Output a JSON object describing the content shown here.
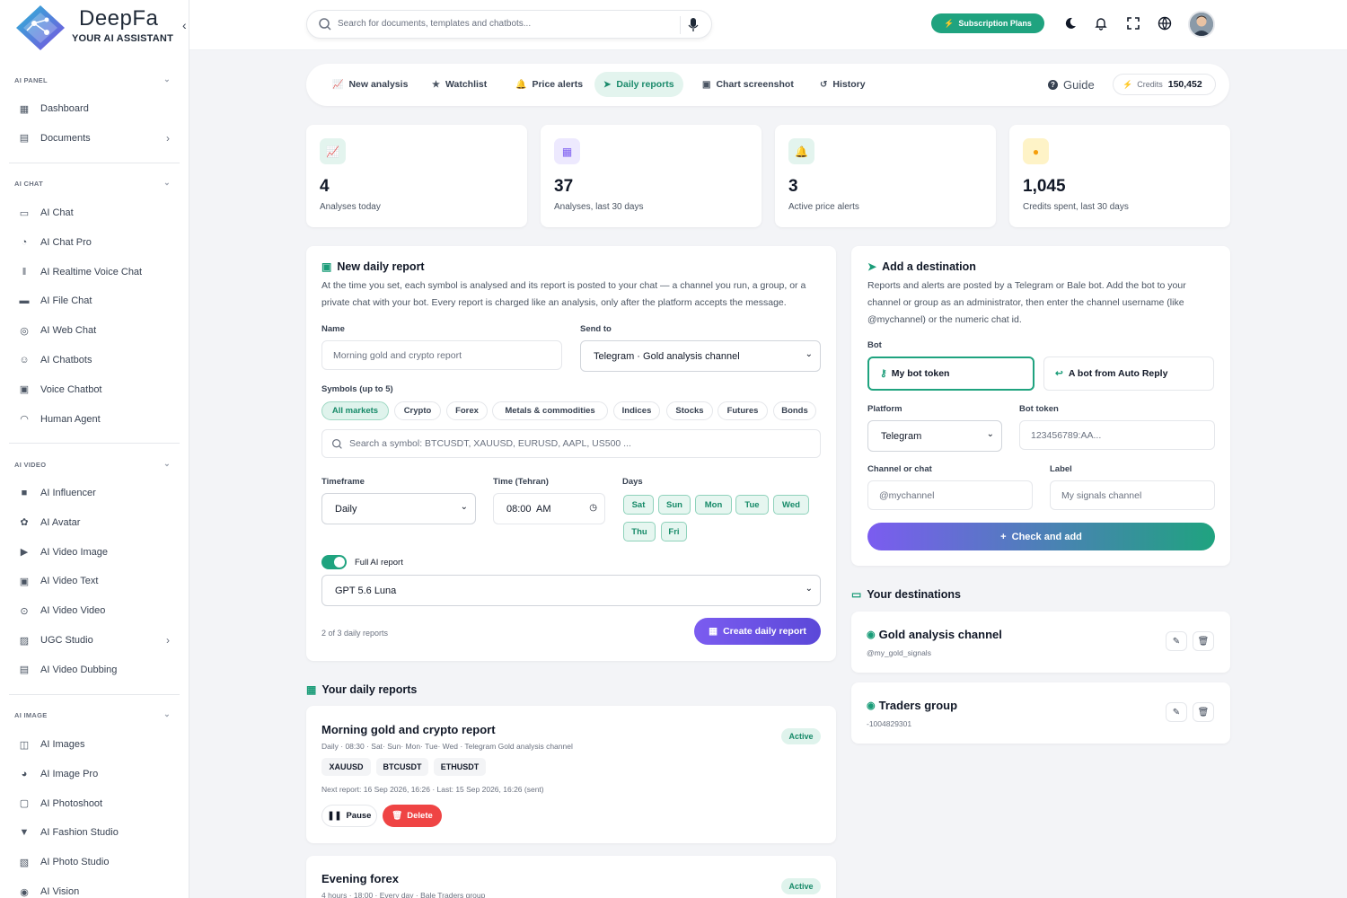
{
  "brand": {
    "name": "DeepFa",
    "tagline": "YOUR AI ASSISTANT"
  },
  "sidebar": {
    "sections": [
      {
        "title": "AI PANEL",
        "items": [
          {
            "label": "Dashboard",
            "icon": "dashboard-icon"
          },
          {
            "label": "Documents",
            "icon": "document-icon",
            "arrow": true
          }
        ]
      },
      {
        "title": "AI CHAT",
        "items": [
          {
            "label": "AI Chat",
            "icon": "chat-icon"
          },
          {
            "label": "AI Chat Pro",
            "icon": "chat-pro-icon"
          },
          {
            "label": "AI Realtime Voice Chat",
            "icon": "waveform-icon"
          },
          {
            "label": "AI File Chat",
            "icon": "folder-icon"
          },
          {
            "label": "AI Web Chat",
            "icon": "globe-icon"
          },
          {
            "label": "AI Chatbots",
            "icon": "robot-icon"
          },
          {
            "label": "Voice Chatbot",
            "icon": "voice-bot-icon"
          },
          {
            "label": "Human Agent",
            "icon": "headset-icon"
          }
        ]
      },
      {
        "title": "AI VIDEO",
        "items": [
          {
            "label": "AI Influencer",
            "icon": "camera-icon"
          },
          {
            "label": "AI Avatar",
            "icon": "avatar-icon"
          },
          {
            "label": "AI Video Image",
            "icon": "video-icon"
          },
          {
            "label": "AI Video Text",
            "icon": "video-text-icon"
          },
          {
            "label": "AI Video Video",
            "icon": "film-icon"
          },
          {
            "label": "UGC Studio",
            "icon": "studio-icon",
            "arrow": true
          },
          {
            "label": "AI Video Dubbing",
            "icon": "dubbing-icon"
          }
        ]
      },
      {
        "title": "AI IMAGE",
        "items": [
          {
            "label": "AI Images",
            "icon": "image-scan-icon"
          },
          {
            "label": "AI Image Pro",
            "icon": "image-pro-icon"
          },
          {
            "label": "AI Photoshoot",
            "icon": "photo-icon"
          },
          {
            "label": "AI Fashion Studio",
            "icon": "shirt-icon"
          },
          {
            "label": "AI Photo Studio",
            "icon": "photo-studio-icon"
          },
          {
            "label": "AI Vision",
            "icon": "vision-icon"
          }
        ]
      }
    ]
  },
  "topbar": {
    "search_placeholder": "Search for documents, templates and chatbots...",
    "subscription": "Subscription Plans"
  },
  "tabs": [
    {
      "label": "New analysis",
      "icon": "chart-line-icon"
    },
    {
      "label": "Watchlist",
      "icon": "star-icon"
    },
    {
      "label": "Price alerts",
      "icon": "bell-icon"
    },
    {
      "label": "Daily reports",
      "icon": "send-icon",
      "active": true
    },
    {
      "label": "Chart screenshot",
      "icon": "image-icon"
    },
    {
      "label": "History",
      "icon": "history-icon"
    }
  ],
  "guide": "Guide",
  "credits": {
    "label": "Credits",
    "value": "150,452"
  },
  "stats": [
    {
      "value": "4",
      "label": "Analyses today",
      "bg": "#e3f4ee",
      "fg": "#1a9c78",
      "icon": "chart-icon"
    },
    {
      "value": "37",
      "label": "Analyses, last 30 days",
      "bg": "#ede9fe",
      "fg": "#7c5cf0",
      "icon": "calendar-icon"
    },
    {
      "value": "3",
      "label": "Active price alerts",
      "bg": "#e3f4ee",
      "fg": "#1a9c78",
      "icon": "bell-icon"
    },
    {
      "value": "1,045",
      "label": "Credits spent, last 30 days",
      "bg": "#fef3c7",
      "fg": "#f59e0b",
      "icon": "coins-icon"
    }
  ],
  "new_report": {
    "title": "New daily report",
    "desc": "At the time you set, each symbol is analysed and its report is posted to your chat — a channel you run, a group, or a private chat with your bot. Every report is charged like an analysis, only after the platform accepts the message.",
    "name_label": "Name",
    "name_placeholder": "Morning gold and crypto report",
    "send_label": "Send to",
    "send_value": "Telegram · Gold analysis channel",
    "symbols_label": "Symbols (up to 5)",
    "markets": [
      "All markets",
      "Crypto",
      "Forex",
      "Metals & commodities",
      "Indices",
      "Stocks",
      "Futures",
      "Bonds"
    ],
    "symbol_search": "Search a symbol: BTCUSDT, XAUUSD, EURUSD, AAPL, US500 ...",
    "timeframe_label": "Timeframe",
    "timeframe_value": "Daily",
    "time_label": "Time (Tehran)",
    "time_value": "08:00  AM",
    "days_label": "Days",
    "days": [
      "Sat",
      "Sun",
      "Mon",
      "Tue",
      "Wed",
      "Thu",
      "Fri"
    ],
    "full_report_label": "Full AI report",
    "model_value": "GPT 5.6 Luna",
    "count_note": "2 of 3 daily reports",
    "create_button": "Create daily report"
  },
  "your_reports": {
    "title": "Your daily reports",
    "items": [
      {
        "name": "Morning gold and crypto report",
        "meta": "Daily · 08:30 · Sat· Sun· Mon· Tue· Wed · Telegram Gold analysis channel",
        "status": "Active",
        "symbols": [
          "XAUUSD",
          "BTCUSDT",
          "ETHUSDT"
        ],
        "next": "Next report: 16 Sep 2026, 16:26 · Last: 15 Sep 2026, 16:26 (sent)",
        "pause": "Pause",
        "delete": "Delete"
      },
      {
        "name": "Evening forex",
        "meta": "4 hours · 18:00 · Every day · Bale Traders group",
        "status": "Active"
      }
    ]
  },
  "add_dest": {
    "title": "Add a destination",
    "desc": "Reports and alerts are posted by a Telegram or Bale bot. Add the bot to your channel or group as an administrator, then enter the channel username (like @mychannel) or the numeric chat id.",
    "bot_label": "Bot",
    "bot_opt1": "My bot token",
    "bot_opt2": "A bot from Auto Reply",
    "platform_label": "Platform",
    "platform_value": "Telegram",
    "token_label": "Bot token",
    "token_placeholder": "123456789:AA...",
    "chat_label": "Channel or chat",
    "chat_placeholder": "@mychannel",
    "label_label": "Label",
    "label_placeholder": "My signals channel",
    "add_button": "+  Check and add"
  },
  "destinations": {
    "title": "Your destinations",
    "items": [
      {
        "name": "Gold analysis channel",
        "sub": "@my_gold_signals",
        "icon": "telegram-icon"
      },
      {
        "name": "Traders group",
        "sub": "-1004829301",
        "icon": "group-chat-icon"
      }
    ]
  }
}
